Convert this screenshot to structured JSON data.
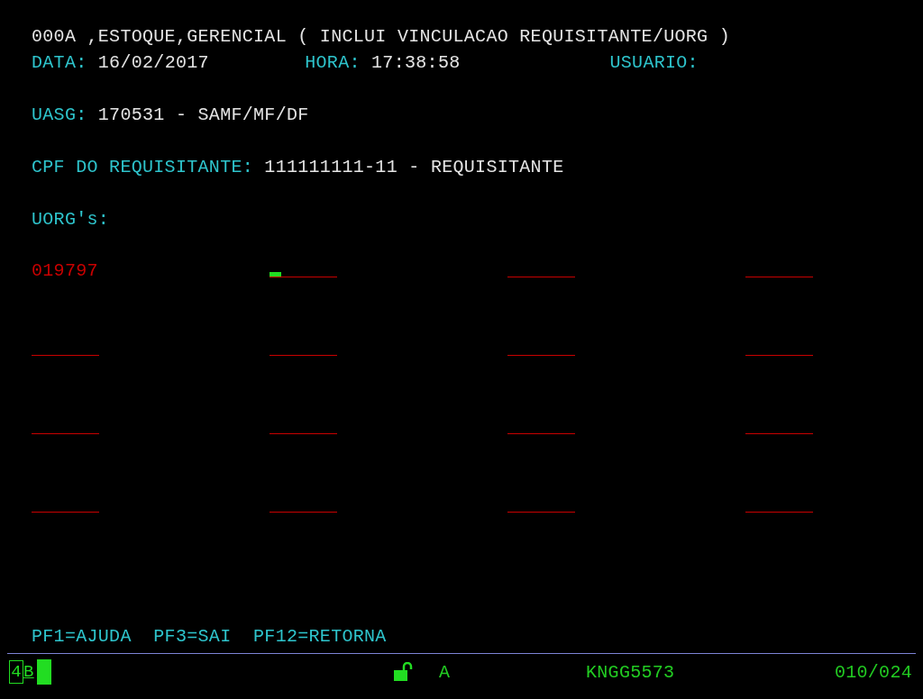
{
  "title": "000A ,ESTOQUE,GERENCIAL ( INCLUI VINCULACAO REQUISITANTE/UORG )",
  "header": [
    {
      "label": "DATA:",
      "value": "16/02/2017"
    },
    {
      "label": "HORA:",
      "value": "17:38:58"
    },
    {
      "label": "USUARIO:"
    }
  ],
  "uasg": {
    "label": "UASG:",
    "value": "170531 - SAMF/MF/DF"
  },
  "cpf": {
    "label": "CPF DO REQUISITANTE:",
    "value": "111111111-11 - REQUISITANTE"
  },
  "uorgs_label": "UORG's:",
  "uorg_fields": [
    {
      "value": "019797",
      "cursor": false
    },
    {
      "cursor": true
    },
    {
      "cursor": false
    },
    {
      "cursor": false
    },
    {
      "cursor": false
    },
    {
      "cursor": false
    },
    {
      "cursor": false
    },
    {
      "cursor": false
    },
    {
      "cursor": false
    },
    {
      "cursor": false
    },
    {
      "cursor": false
    },
    {
      "cursor": false
    },
    {
      "cursor": false
    },
    {
      "cursor": false
    },
    {
      "cursor": false
    },
    {
      "cursor": false
    }
  ],
  "function_keys": "PF1=AJUDA  PF3=SAI  PF12=RETORNA",
  "status_bar": {
    "session": "4",
    "mode": "B",
    "indicator": "A",
    "terminal": "KNGG5573",
    "cursor_position": "010/024"
  }
}
